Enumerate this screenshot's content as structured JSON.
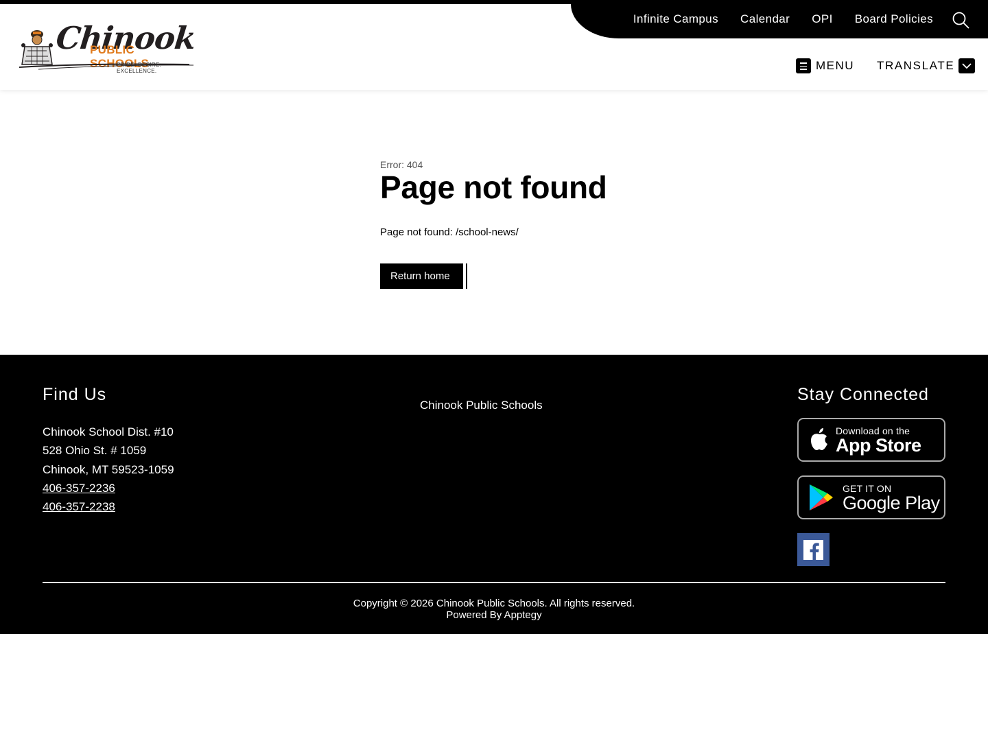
{
  "header": {
    "logo": {
      "name": "Chinook",
      "subtitle": "PUBLIC SCHOOLS",
      "tagline": "PRIDE. DESIRE. EXCELLENCE."
    },
    "utility_links": [
      "Infinite Campus",
      "Calendar",
      "OPI",
      "Board Policies"
    ],
    "menu_label": "MENU",
    "translate_label": "TRANSLATE"
  },
  "main": {
    "error_code": "Error: 404",
    "title": "Page not found",
    "message": "Page not found: /school-news/",
    "return_label": "Return home"
  },
  "footer": {
    "find_us_title": "Find Us",
    "address_lines": [
      "Chinook School Dist. #10",
      "528 Ohio St. # 1059",
      "Chinook, MT 59523-1059"
    ],
    "phones": [
      "406-357-2236",
      "406-357-2238"
    ],
    "center_name": "Chinook Public Schools",
    "stay_connected_title": "Stay Connected",
    "app_store": {
      "small": "Download on the",
      "big": "App Store"
    },
    "google_play": {
      "small": "GET IT ON",
      "big": "Google Play"
    },
    "copyright": "Copyright © 2026 Chinook Public Schools. All rights reserved.",
    "powered_by": "Powered By Apptegy"
  },
  "colors": {
    "accent": "#e07b1e",
    "dark": "#000000",
    "facebook": "#3b5998"
  }
}
